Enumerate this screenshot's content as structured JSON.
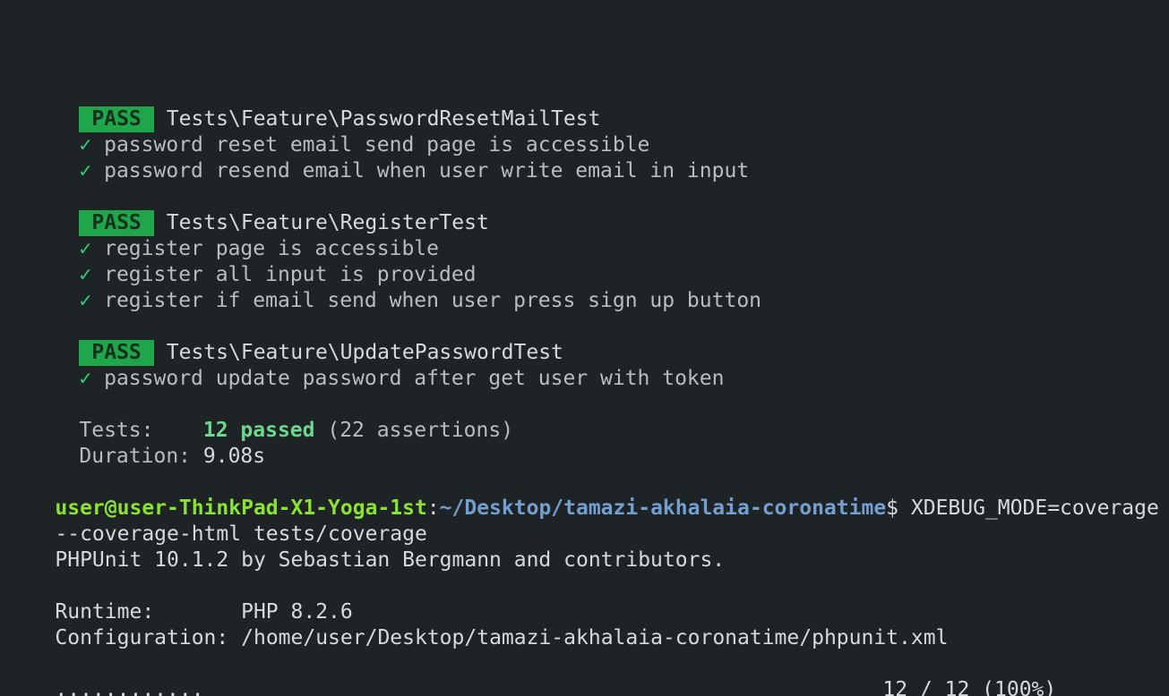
{
  "suites": [
    {
      "badge": "PASS",
      "name": "Tests\\Feature\\PasswordResetMailTest",
      "tests": [
        "password reset email send page is accessible",
        "password resend email when user write email in input"
      ]
    },
    {
      "badge": "PASS",
      "name": "Tests\\Feature\\RegisterTest",
      "tests": [
        "register page is accessible",
        "register all input is provided",
        "register if email send when user press sign up button"
      ]
    },
    {
      "badge": "PASS",
      "name": "Tests\\Feature\\UpdatePasswordTest",
      "tests": [
        "password update password after get user with token"
      ]
    }
  ],
  "check_mark": "✓",
  "summary": {
    "tests_label": "Tests:",
    "passed": "12 passed",
    "assertions": "(22 assertions)",
    "duration_label": "Duration:",
    "duration": "9.08s"
  },
  "prompt": {
    "user_host": "user@user-ThinkPad-X1-Yoga-1st",
    "colon": ":",
    "path": "~/Desktop/tamazi-akhalaia-coronatime",
    "dollar": "$",
    "command": " XDEBUG_MODE=coverage ./v",
    "command_cont": "--coverage-html tests/coverage"
  },
  "phpunit": {
    "banner": "PHPUnit 10.1.2 by Sebastian Bergmann and contributors.",
    "runtime_label": "Runtime:",
    "runtime": "PHP 8.2.6",
    "config_label": "Configuration:",
    "config": "/home/user/Desktop/tamazi-akhalaia-coronatime/phpunit.xml",
    "dots": "............",
    "progress": "12 / 12 (100%)"
  },
  "colors": {
    "background": "#1e2326",
    "pass_badge": "#1fa64b",
    "check": "#2ecc71",
    "prompt_user": "#8ae234",
    "prompt_path": "#729fcf"
  }
}
